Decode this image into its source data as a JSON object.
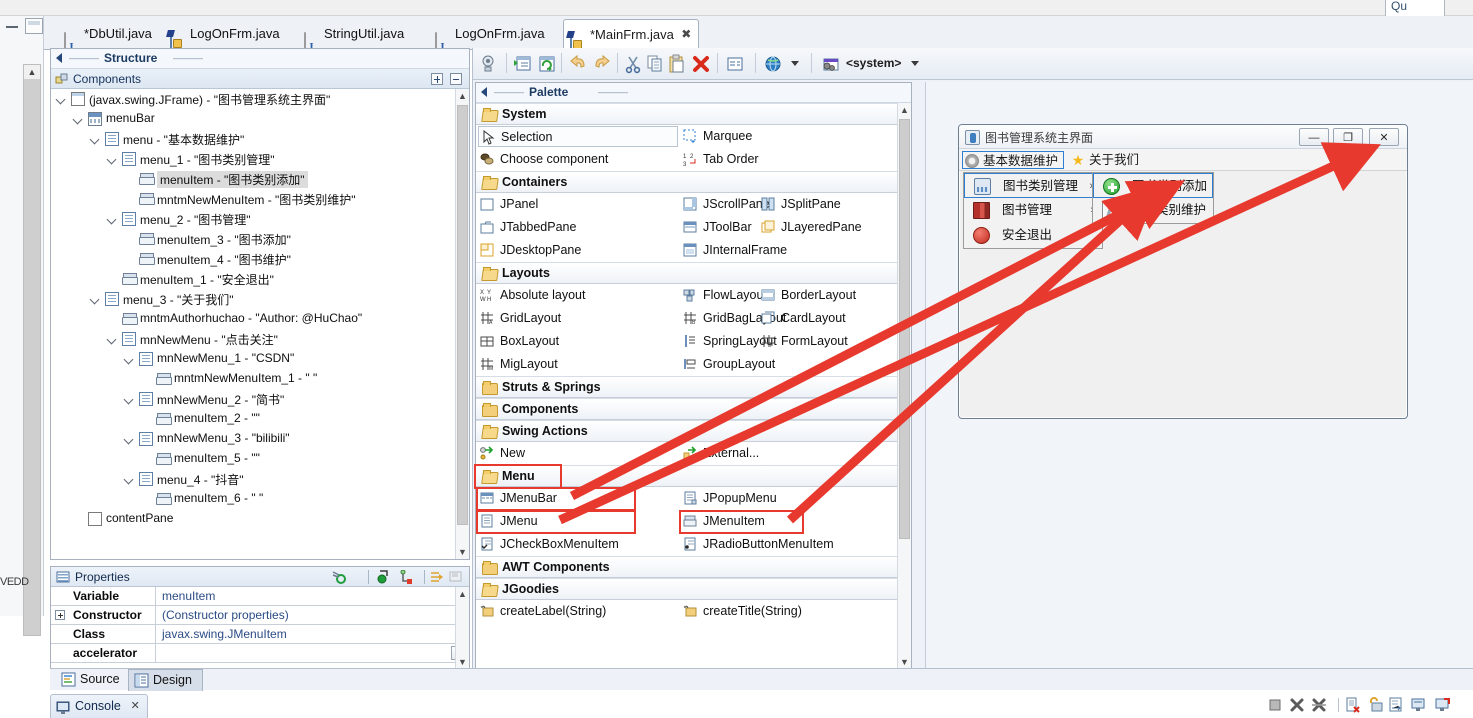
{
  "window": {
    "top_right_tab": "Qu"
  },
  "editor_tabs": [
    {
      "label": "*DbUtil.java",
      "icon": "java-file-icon",
      "active": false
    },
    {
      "label": "LogOnFrm.java",
      "icon": "java-class-designer-icon",
      "active": false
    },
    {
      "label": "StringUtil.java",
      "icon": "java-file-icon",
      "active": false
    },
    {
      "label": "LogOnFrm.java",
      "icon": "java-file-icon",
      "active": false
    },
    {
      "label": "*MainFrm.java",
      "icon": "java-class-designer-icon",
      "active": true
    }
  ],
  "structure_view": {
    "title": "Structure",
    "components_header": "Components",
    "expand_all_tooltip": "+",
    "collapse_all_tooltip": "-",
    "tree": [
      {
        "indent": 0,
        "icon": "jframe-icon",
        "label": "(javax.swing.JFrame) - \"图书管理系统主界面\"",
        "expanded": true,
        "selected": false
      },
      {
        "indent": 1,
        "icon": "menubar-icon",
        "label": "menuBar",
        "expanded": true,
        "selected": false
      },
      {
        "indent": 2,
        "icon": "menu-icon",
        "label": "menu - \"基本数据维护\"",
        "expanded": true,
        "selected": false
      },
      {
        "indent": 3,
        "icon": "menu-icon",
        "label": "menu_1 - \"图书类别管理\"",
        "expanded": true,
        "selected": false
      },
      {
        "indent": 4,
        "icon": "menuitem-icon",
        "label": "menuItem - \"图书类别添加\"",
        "expanded": false,
        "selected": true
      },
      {
        "indent": 4,
        "icon": "menuitem-icon",
        "label": "mntmNewMenuItem - \"图书类别维护\"",
        "expanded": false,
        "selected": false
      },
      {
        "indent": 3,
        "icon": "menu-icon",
        "label": "menu_2 - \"图书管理\"",
        "expanded": true,
        "selected": false
      },
      {
        "indent": 4,
        "icon": "menuitem-icon",
        "label": "menuItem_3 - \"图书添加\"",
        "expanded": false,
        "selected": false
      },
      {
        "indent": 4,
        "icon": "menuitem-icon",
        "label": "menuItem_4 - \"图书维护\"",
        "expanded": false,
        "selected": false
      },
      {
        "indent": 3,
        "icon": "menuitem-icon",
        "label": "menuItem_1 - \"安全退出\"",
        "expanded": false,
        "selected": false
      },
      {
        "indent": 2,
        "icon": "menu-icon",
        "label": "menu_3 - \"关于我们\"",
        "expanded": true,
        "selected": false
      },
      {
        "indent": 3,
        "icon": "menuitem-icon",
        "label": "mntmAuthorhuchao - \"Author: @HuChao\"",
        "expanded": false,
        "selected": false
      },
      {
        "indent": 3,
        "icon": "menu-icon",
        "label": "mnNewMenu - \"点击关注\"",
        "expanded": true,
        "selected": false
      },
      {
        "indent": 4,
        "icon": "menu-icon",
        "label": "mnNewMenu_1 - \"CSDN\"",
        "expanded": true,
        "selected": false
      },
      {
        "indent": 5,
        "icon": "menuitem-icon",
        "label": "mntmNewMenuItem_1 - \"  \"",
        "expanded": false,
        "selected": false
      },
      {
        "indent": 4,
        "icon": "menu-icon",
        "label": "mnNewMenu_2 - \"简书\"",
        "expanded": true,
        "selected": false
      },
      {
        "indent": 5,
        "icon": "menuitem-icon",
        "label": "menuItem_2 - \"\"",
        "expanded": false,
        "selected": false
      },
      {
        "indent": 4,
        "icon": "menu-icon",
        "label": "mnNewMenu_3 - \"bilibili\"",
        "expanded": true,
        "selected": false
      },
      {
        "indent": 5,
        "icon": "menuitem-icon",
        "label": "menuItem_5 - \"\"",
        "expanded": false,
        "selected": false
      },
      {
        "indent": 4,
        "icon": "menu-icon",
        "label": "menu_4 - \"抖音\"",
        "expanded": true,
        "selected": false
      },
      {
        "indent": 5,
        "icon": "menuitem-icon",
        "label": "menuItem_6 - \"  \"",
        "expanded": false,
        "selected": false
      },
      {
        "indent": 1,
        "icon": "contentpane-icon",
        "label": "contentPane",
        "expanded": false,
        "selected": false
      }
    ]
  },
  "properties_view": {
    "title": "Properties",
    "rows": [
      {
        "key": "Variable",
        "value": "menuItem",
        "expandable": false,
        "has_ellipsis": false
      },
      {
        "key": "Constructor",
        "value": "(Constructor properties)",
        "expandable": true,
        "has_ellipsis": false
      },
      {
        "key": "Class",
        "value": "javax.swing.JMenuItem",
        "expandable": false,
        "has_ellipsis": false
      },
      {
        "key": "accelerator",
        "value": "",
        "expandable": false,
        "has_ellipsis": true
      }
    ],
    "ellipsis_label": "...",
    "toolbar_icons": [
      "refresh-properties-icon",
      "show-advanced-icon",
      "show-events-icon",
      "goto-definition-icon",
      "restore-defaults-icon"
    ]
  },
  "wb_toolbar": {
    "icons": [
      "test-preview-icon",
      "open-in-editor-icon",
      "refresh-icon",
      "undo-icon",
      "redo-icon",
      "cut-icon",
      "copy-icon",
      "paste-icon",
      "delete-icon",
      "properties-icon",
      "globe-icon"
    ],
    "locale_selector_label": "<system>",
    "locale_icon": "system-look-and-feel-icon"
  },
  "palette": {
    "title": "Palette",
    "categories": [
      {
        "name": "System",
        "open": true,
        "items": [
          {
            "label": "Selection",
            "icon": "selection-cursor-icon",
            "col": 0,
            "boxed": true
          },
          {
            "label": "Marquee",
            "icon": "marquee-icon",
            "col": 1,
            "boxed": false
          },
          {
            "label": "Choose component",
            "icon": "choose-component-icon",
            "col": 0,
            "boxed": false
          },
          {
            "label": "Tab Order",
            "icon": "tab-order-icon",
            "col": 1,
            "boxed": false
          }
        ]
      },
      {
        "name": "Containers",
        "open": true,
        "items": [
          {
            "label": "JPanel",
            "icon": "jpanel-icon",
            "col": 0,
            "boxed": false
          },
          {
            "label": "JScrollPane",
            "icon": "jscrollpane-icon",
            "col": 1,
            "boxed": false
          },
          {
            "label": "JSplitPane",
            "icon": "jsplitpane-icon",
            "col": 2,
            "boxed": false
          },
          {
            "label": "JTabbedPane",
            "icon": "jtabbedpane-icon",
            "col": 0,
            "boxed": false
          },
          {
            "label": "JToolBar",
            "icon": "jtoolbar-icon",
            "col": 1,
            "boxed": false
          },
          {
            "label": "JLayeredPane",
            "icon": "jlayeredpane-icon",
            "col": 2,
            "boxed": false
          },
          {
            "label": "JDesktopPane",
            "icon": "jdesktoppane-icon",
            "col": 0,
            "boxed": false
          },
          {
            "label": "JInternalFrame",
            "icon": "jinternalframe-icon",
            "col": 1,
            "boxed": false
          }
        ]
      },
      {
        "name": "Layouts",
        "open": true,
        "items": [
          {
            "label": "Absolute layout",
            "icon": "absolute-layout-icon",
            "col": 0,
            "boxed": false
          },
          {
            "label": "FlowLayout",
            "icon": "flowlayout-icon",
            "col": 1,
            "boxed": false
          },
          {
            "label": "BorderLayout",
            "icon": "borderlayout-icon",
            "col": 2,
            "boxed": false
          },
          {
            "label": "GridLayout",
            "icon": "gridlayout-icon",
            "col": 0,
            "boxed": false
          },
          {
            "label": "GridBagLayout",
            "icon": "gridbaglayout-icon",
            "col": 1,
            "boxed": false
          },
          {
            "label": "CardLayout",
            "icon": "cardlayout-icon",
            "col": 2,
            "boxed": false
          },
          {
            "label": "BoxLayout",
            "icon": "boxlayout-icon",
            "col": 0,
            "boxed": false
          },
          {
            "label": "SpringLayout",
            "icon": "springlayout-icon",
            "col": 1,
            "boxed": false
          },
          {
            "label": "FormLayout",
            "icon": "formlayout-icon",
            "col": 2,
            "boxed": false
          },
          {
            "label": "MigLayout",
            "icon": "miglayout-icon",
            "col": 0,
            "boxed": false
          },
          {
            "label": "GroupLayout",
            "icon": "grouplayout-icon",
            "col": 1,
            "boxed": false
          }
        ]
      },
      {
        "name": "Struts & Springs",
        "open": false,
        "items": []
      },
      {
        "name": "Components",
        "open": false,
        "items": []
      },
      {
        "name": "Swing Actions",
        "open": true,
        "items": [
          {
            "label": "New",
            "icon": "new-action-icon",
            "col": 0,
            "boxed": false
          },
          {
            "label": "External...",
            "icon": "external-action-icon",
            "col": 1,
            "boxed": false
          }
        ]
      },
      {
        "name": "Menu",
        "open": true,
        "highlighted": true,
        "items": [
          {
            "label": "JMenuBar",
            "icon": "jmenubar-icon",
            "col": 0,
            "boxed": false,
            "highlighted": true
          },
          {
            "label": "JPopupMenu",
            "icon": "jpopupmenu-icon",
            "col": 1,
            "boxed": false,
            "highlighted": false
          },
          {
            "label": "JMenu",
            "icon": "jmenu-icon",
            "col": 0,
            "boxed": false,
            "highlighted": true
          },
          {
            "label": "JMenuItem",
            "icon": "jmenuitem-icon",
            "col": 1,
            "boxed": false,
            "highlighted": true
          },
          {
            "label": "JCheckBoxMenuItem",
            "icon": "jcheckboxmenuitem-icon",
            "col": 0,
            "boxed": false,
            "highlighted": false
          },
          {
            "label": "JRadioButtonMenuItem",
            "icon": "jradiobuttonmenuitem-icon",
            "col": 1,
            "boxed": false,
            "highlighted": false
          }
        ]
      },
      {
        "name": "AWT Components",
        "open": false,
        "items": []
      },
      {
        "name": "JGoodies",
        "open": true,
        "items": [
          {
            "label": "createLabel(String)",
            "icon": "factory-method-icon",
            "col": 0,
            "boxed": false
          },
          {
            "label": "createTitle(String)",
            "icon": "factory-method-icon",
            "col": 1,
            "boxed": false
          }
        ]
      }
    ]
  },
  "design_canvas": {
    "frame_title": "图书管理系统主界面",
    "window_buttons": [
      {
        "name": "minimize",
        "glyph": "—"
      },
      {
        "name": "maximize",
        "glyph": "❐"
      },
      {
        "name": "close",
        "glyph": "✕"
      }
    ],
    "menubar": [
      {
        "label": "基本数据维护",
        "icon": "gear-icon",
        "selected": true
      },
      {
        "label": "关于我们",
        "icon": "star-icon",
        "selected": false
      }
    ],
    "dropdown_menu": {
      "items": [
        {
          "label": "图书类别管理",
          "icon": "category-icon",
          "submenu": true,
          "selected": true
        },
        {
          "label": "图书管理",
          "icon": "book-icon",
          "submenu": true,
          "selected": false
        },
        {
          "label": "安全退出",
          "icon": "exit-icon",
          "submenu": false,
          "selected": false
        }
      ]
    },
    "submenu": {
      "items": [
        {
          "label": "图书类别添加",
          "icon": "add-green-icon",
          "selected": true
        },
        {
          "label": "图书类别维护",
          "icon": "edit-pencil-icon",
          "selected": false
        }
      ]
    }
  },
  "bottom_tabs": [
    {
      "label": "Source",
      "icon": "source-editor-icon",
      "active": false
    },
    {
      "label": "Design",
      "icon": "design-editor-icon",
      "active": true
    }
  ],
  "console": {
    "title": "Console",
    "close_glyph": "✕",
    "toolbar_icons": [
      "terminate-icon",
      "remove-launch-icon",
      "remove-all-terminated-icon",
      "clear-console-icon",
      "scroll-lock-icon",
      "word-wrap-icon",
      "display-selected-console-icon",
      "open-console-icon"
    ]
  },
  "annotations": {
    "arrow_color": "#e8392e",
    "highlight_box_color": "#e8392e",
    "selection_box_color": "#2f7fd0",
    "arrow_count": 3
  }
}
